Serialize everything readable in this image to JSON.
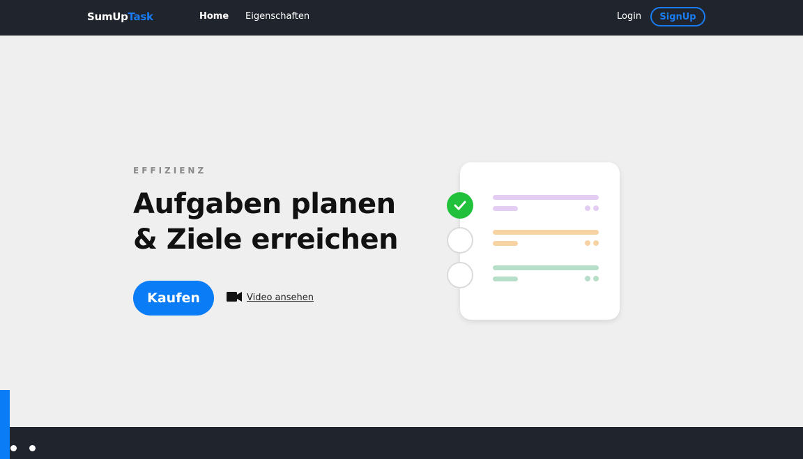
{
  "nav": {
    "logo_primary": "SumUp",
    "logo_accent": "Task",
    "home": "Home",
    "features": "Eigenschaften",
    "login": "Login",
    "signup": "SignUp"
  },
  "hero": {
    "eyebrow": "EFFIZIENZ",
    "headline_line1": "Aufgaben planen",
    "headline_line2": "& Ziele erreichen",
    "buy_button": "Kaufen",
    "video_link": "Video ansehen",
    "video_icon": "video-camera-icon"
  },
  "task_card": {
    "items": [
      {
        "status": "completed",
        "color": "#e3cdf3",
        "check_color": "#22c13b"
      },
      {
        "status": "open",
        "color": "#f7d2a3"
      },
      {
        "status": "open",
        "color": "#b7dec9"
      }
    ]
  },
  "colors": {
    "nav_background": "#20252d",
    "brand_blue": "#0a7cf5",
    "page_background": "#efefef",
    "heading": "#111111"
  }
}
